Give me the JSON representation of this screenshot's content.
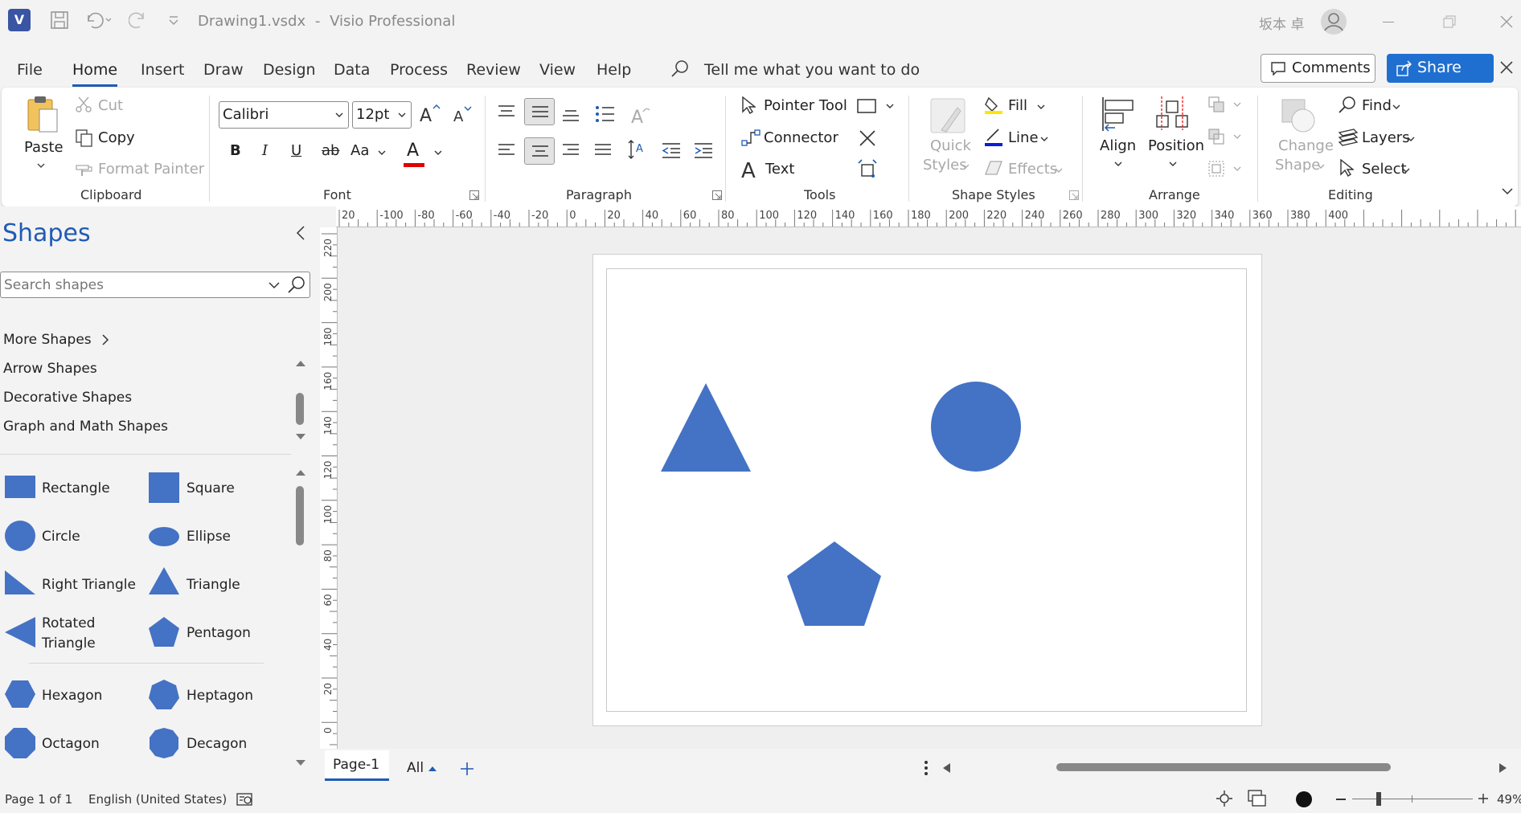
{
  "titlebar": {
    "doc_title": "Drawing1.vsdx",
    "separator": "-",
    "app_name": "Visio Professional",
    "user_name": "坂本 卓"
  },
  "menu": {
    "tabs": [
      "File",
      "Home",
      "Insert",
      "Draw",
      "Design",
      "Data",
      "Process",
      "Review",
      "View",
      "Help"
    ],
    "active": "Home",
    "search_text": "Tell me what you want to do",
    "comments": "Comments",
    "share": "Share"
  },
  "ribbon": {
    "clipboard": {
      "paste": "Paste",
      "cut": "Cut",
      "copy": "Copy",
      "format_painter": "Format Painter",
      "label": "Clipboard"
    },
    "font": {
      "name": "Calibri",
      "size": "12pt",
      "bold": "B",
      "italic": "I",
      "underline": "U",
      "strike": "ab",
      "case": "Aa",
      "color_letter": "A",
      "label": "Font"
    },
    "paragraph": {
      "label": "Paragraph"
    },
    "tools": {
      "pointer": "Pointer Tool",
      "connector": "Connector",
      "text": "Text",
      "label": "Tools"
    },
    "shape_styles": {
      "quick_styles": "Quick",
      "quick_styles2": "Styles",
      "fill": "Fill",
      "line": "Line",
      "effects": "Effects",
      "label": "Shape Styles"
    },
    "arrange": {
      "align": "Align",
      "position": "Position",
      "label": "Arrange"
    },
    "editing": {
      "change_shape": "Change",
      "change_shape2": "Shape",
      "find": "Find",
      "layers": "Layers",
      "select": "Select",
      "label": "Editing"
    }
  },
  "shapes_panel": {
    "title": "Shapes",
    "search_placeholder": "Search shapes",
    "more_shapes": "More Shapes",
    "stencils": [
      "Arrow Shapes",
      "Decorative Shapes",
      "Graph and Math Shapes"
    ],
    "items": [
      "Rectangle",
      "Square",
      "Circle",
      "Ellipse",
      "Right Triangle",
      "Triangle",
      "Rotated",
      "Triangle",
      "Pentagon",
      "Hexagon",
      "Heptagon",
      "Octagon",
      "Decagon"
    ]
  },
  "ruler": {
    "h_labels": [
      "20",
      "-100",
      "-80",
      "-60",
      "-40",
      "-20",
      "0",
      "20",
      "40",
      "60",
      "80",
      "100",
      "120",
      "140",
      "160",
      "180",
      "200",
      "220",
      "240",
      "260",
      "280",
      "300",
      "320",
      "340",
      "360",
      "380",
      "400"
    ],
    "v_labels": [
      "220",
      "200",
      "180",
      "160",
      "140",
      "120",
      "100",
      "80",
      "60",
      "40",
      "20",
      "0"
    ]
  },
  "page_tabs": {
    "current": "Page-1",
    "all": "All"
  },
  "status": {
    "page": "Page 1 of 1",
    "language": "English (United States)",
    "zoom": "49%"
  },
  "colors": {
    "accent": "#1f5bb5",
    "shape_fill": "#4472c4",
    "share_bg": "#1f6fd1"
  }
}
